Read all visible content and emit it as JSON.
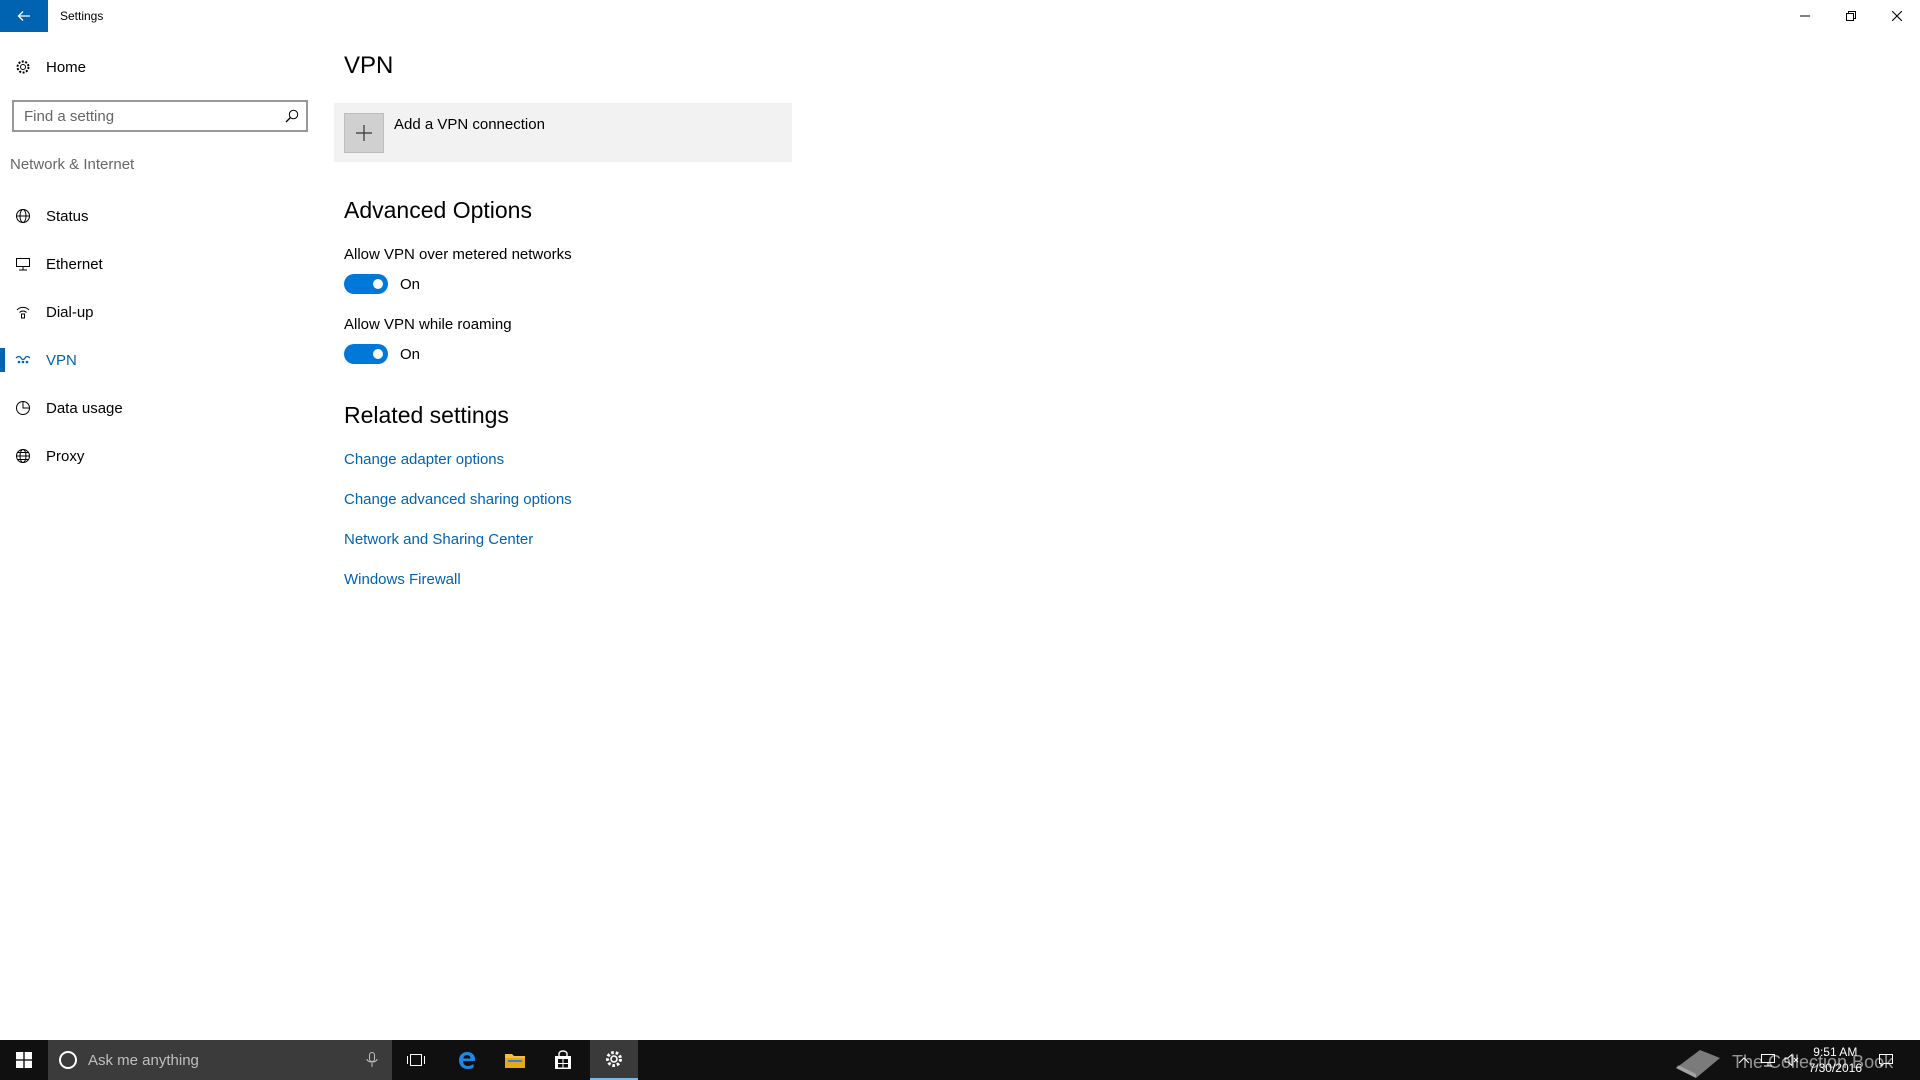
{
  "window": {
    "title": "Settings"
  },
  "sidebar": {
    "home_label": "Home",
    "search_placeholder": "Find a setting",
    "section_title": "Network & Internet",
    "items": [
      {
        "label": "Status",
        "icon": "globe-status-icon"
      },
      {
        "label": "Ethernet",
        "icon": "ethernet-icon"
      },
      {
        "label": "Dial-up",
        "icon": "dial-up-icon"
      },
      {
        "label": "VPN",
        "icon": "vpn-icon",
        "active": true
      },
      {
        "label": "Data usage",
        "icon": "data-usage-icon"
      },
      {
        "label": "Proxy",
        "icon": "globe-icon"
      }
    ]
  },
  "main": {
    "title": "VPN",
    "add_vpn_label": "Add a VPN connection",
    "advanced_title": "Advanced Options",
    "options": [
      {
        "label": "Allow VPN over metered networks",
        "state": "On"
      },
      {
        "label": "Allow VPN while roaming",
        "state": "On"
      }
    ],
    "related_title": "Related settings",
    "links": [
      "Change adapter options",
      "Change advanced sharing options",
      "Network and Sharing Center",
      "Windows Firewall"
    ]
  },
  "taskbar": {
    "search_placeholder": "Ask me anything",
    "time": "9:51 AM",
    "date": "7/30/2016",
    "watermark": "The Collection Book"
  },
  "colors": {
    "accent": "#0063b1",
    "toggle_on": "#0078d7",
    "add_tile_bg": "#f2f2f2",
    "taskbar_bg": "#101010"
  }
}
